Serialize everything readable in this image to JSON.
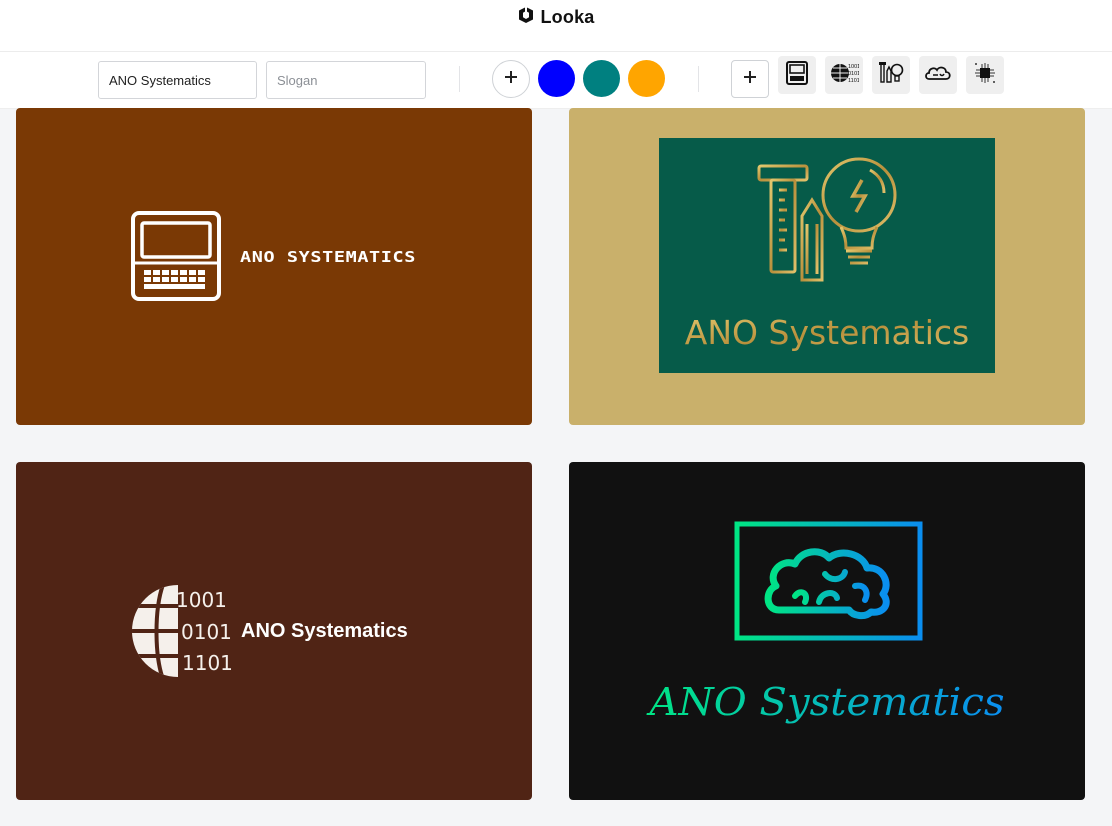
{
  "brand": {
    "name": "Looka",
    "icon": "looka-logo-icon"
  },
  "toolbar": {
    "company_name_value": "ANO Systematics",
    "slogan_placeholder": "Slogan",
    "add_color_icon": "plus-icon",
    "colors": [
      {
        "name": "blue",
        "hex": "#0000ff"
      },
      {
        "name": "teal",
        "hex": "#008080"
      },
      {
        "name": "orange",
        "hex": "#ffa500"
      }
    ],
    "add_symbol_icon": "plus-icon",
    "symbols": [
      "laptop-icon",
      "binary-globe-icon",
      "tools-lightbulb-icon",
      "cloud-brain-icon",
      "microchip-icon"
    ]
  },
  "logos": [
    {
      "name": "laptop-logo",
      "company": "ANO SYSTEMATICS",
      "background": "#7a3905",
      "text_color": "#ffffff",
      "icon": "laptop-icon"
    },
    {
      "name": "tools-lightbulb-logo",
      "company": "ANO Systematics",
      "background": "#c9b06b",
      "panel_color": "#065b49",
      "text_color": "#c9a85a",
      "icon": "tools-lightbulb-icon"
    },
    {
      "name": "binary-globe-logo",
      "company": "ANO Systematics",
      "binary_lines": [
        "1001",
        "0101",
        "1101"
      ],
      "background": "#502415",
      "text_color": "#ffffff",
      "icon": "binary-globe-icon"
    },
    {
      "name": "brain-frame-logo",
      "company": "ANO Systematics",
      "background": "#111111",
      "gradient_start": "#00e584",
      "gradient_end": "#0a8ef0",
      "icon": "brain-icon"
    }
  ]
}
